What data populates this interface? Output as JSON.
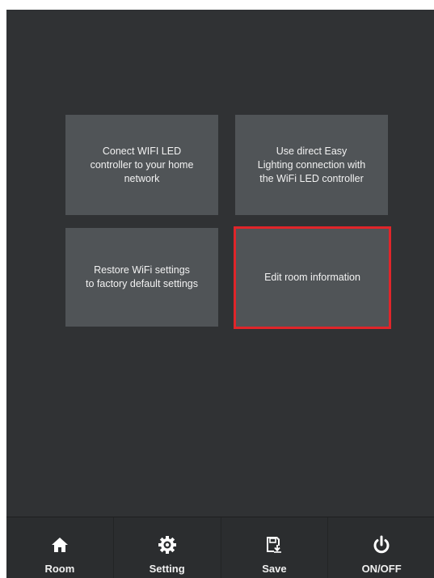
{
  "tiles": {
    "connect": "Conect WIFI LED\ncontroller to your home\nnetwork",
    "easy": "Use direct Easy\nLighting connection with\nthe WiFi LED controller",
    "restore": "Restore WiFi settings\nto factory default settings",
    "edit_room": "Edit room information"
  },
  "tabbar": {
    "items": [
      {
        "label": "Room",
        "icon": "home-icon"
      },
      {
        "label": "Setting",
        "icon": "gear-icon"
      },
      {
        "label": "Save",
        "icon": "save-icon"
      },
      {
        "label": "ON/OFF",
        "icon": "power-icon"
      }
    ]
  },
  "colors": {
    "background": "#303234",
    "tile": "#505457",
    "selected_border": "#e0252a"
  }
}
